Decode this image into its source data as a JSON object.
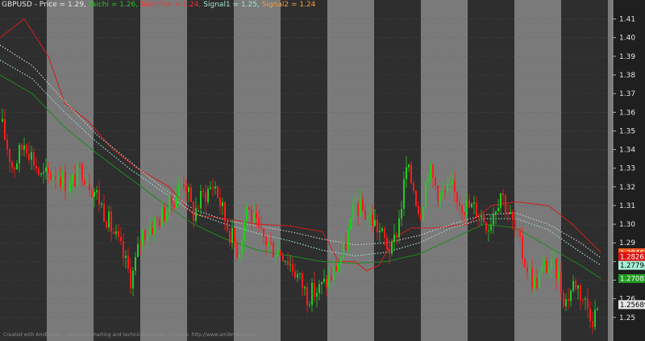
{
  "header": {
    "symbol": "GBPUSD",
    "price_label": "Price = 1.29,",
    "taichi_label": "Taichi = 1.26,",
    "taichifor_label": "TaichiFor = 1.24,",
    "signal1_label": "Signal1 = 1.25,",
    "signal2_label": "Signal2 = 1.24"
  },
  "footer": {
    "text": "Created with AmiBroker - advanced charting and technical analysis software. http://www.amibroker.com"
  },
  "colors": {
    "background_dark": "#2e2e2e",
    "background_light": "#7a7a7a",
    "up_candle": "#22cc22",
    "down_candle": "#ff1a1a",
    "taichi": "#1f8a1f",
    "taichifor": "#d21e1e",
    "signal1": "#9fd8c8",
    "signal2": "#c8c8c8"
  },
  "chart_data": {
    "type": "candlestick",
    "y_axis": {
      "min": 1.243,
      "max": 1.415,
      "ticks": [
        "1.25",
        "1.26",
        "1.27",
        "1.28",
        "1.29",
        "1.30",
        "1.31",
        "1.32",
        "1.33",
        "1.34",
        "1.35",
        "1.36",
        "1.37",
        "1.38",
        "1.39",
        "1.40",
        "1.41"
      ]
    },
    "last_values": {
      "taichifor": "1.28467",
      "signal2": "1.28263",
      "signal1": "1.27794",
      "taichi": "1.27085",
      "price": "1.25689"
    },
    "price_path": [
      [
        0,
        1.355
      ],
      [
        15,
        1.33
      ],
      [
        30,
        1.345
      ],
      [
        50,
        1.325
      ],
      [
        70,
        1.328
      ],
      [
        85,
        1.32
      ],
      [
        100,
        1.33
      ],
      [
        120,
        1.315
      ],
      [
        135,
        1.3
      ],
      [
        150,
        1.285
      ],
      [
        162,
        1.27
      ],
      [
        175,
        1.295
      ],
      [
        190,
        1.3
      ],
      [
        210,
        1.31
      ],
      [
        228,
        1.325
      ],
      [
        238,
        1.305
      ],
      [
        250,
        1.315
      ],
      [
        265,
        1.322
      ],
      [
        280,
        1.3
      ],
      [
        295,
        1.285
      ],
      [
        305,
        1.31
      ],
      [
        320,
        1.295
      ],
      [
        335,
        1.288
      ],
      [
        350,
        1.285
      ],
      [
        365,
        1.275
      ],
      [
        380,
        1.262
      ],
      [
        395,
        1.265
      ],
      [
        410,
        1.272
      ],
      [
        425,
        1.285
      ],
      [
        440,
        1.31
      ],
      [
        455,
        1.305
      ],
      [
        465,
        1.3
      ],
      [
        475,
        1.292
      ],
      [
        485,
        1.285
      ],
      [
        495,
        1.305
      ],
      [
        503,
        1.33
      ],
      [
        512,
        1.32
      ],
      [
        520,
        1.305
      ],
      [
        530,
        1.33
      ],
      [
        545,
        1.315
      ],
      [
        560,
        1.318
      ],
      [
        575,
        1.31
      ],
      [
        590,
        1.308
      ],
      [
        605,
        1.3
      ],
      [
        620,
        1.318
      ],
      [
        635,
        1.3
      ],
      [
        650,
        1.28
      ],
      [
        662,
        1.268
      ],
      [
        675,
        1.278
      ],
      [
        690,
        1.275
      ],
      [
        700,
        1.258
      ],
      [
        712,
        1.27
      ],
      [
        725,
        1.258
      ],
      [
        735,
        1.25
      ],
      [
        742,
        1.257
      ]
    ],
    "taichi": [
      [
        0,
        1.38
      ],
      [
        40,
        1.37
      ],
      [
        80,
        1.352
      ],
      [
        120,
        1.338
      ],
      [
        160,
        1.325
      ],
      [
        200,
        1.312
      ],
      [
        240,
        1.3
      ],
      [
        280,
        1.292
      ],
      [
        320,
        1.286
      ],
      [
        360,
        1.283
      ],
      [
        400,
        1.28
      ],
      [
        440,
        1.279
      ],
      [
        480,
        1.28
      ],
      [
        520,
        1.284
      ],
      [
        560,
        1.292
      ],
      [
        600,
        1.3
      ],
      [
        640,
        1.298
      ],
      [
        680,
        1.288
      ],
      [
        720,
        1.278
      ],
      [
        745,
        1.271
      ]
    ],
    "taichifor": [
      [
        0,
        1.4
      ],
      [
        15,
        1.405
      ],
      [
        30,
        1.41
      ],
      [
        45,
        1.4
      ],
      [
        60,
        1.39
      ],
      [
        80,
        1.365
      ],
      [
        110,
        1.355
      ],
      [
        140,
        1.34
      ],
      [
        170,
        1.33
      ],
      [
        210,
        1.32
      ],
      [
        240,
        1.305
      ],
      [
        280,
        1.303
      ],
      [
        320,
        1.3
      ],
      [
        360,
        1.299
      ],
      [
        400,
        1.296
      ],
      [
        420,
        1.28
      ],
      [
        440,
        1.28
      ],
      [
        455,
        1.275
      ],
      [
        470,
        1.278
      ],
      [
        490,
        1.293
      ],
      [
        510,
        1.298
      ],
      [
        540,
        1.298
      ],
      [
        580,
        1.3
      ],
      [
        610,
        1.31
      ],
      [
        640,
        1.312
      ],
      [
        680,
        1.31
      ],
      [
        710,
        1.3
      ],
      [
        745,
        1.285
      ]
    ],
    "signal1": [
      [
        0,
        1.388
      ],
      [
        40,
        1.378
      ],
      [
        80,
        1.36
      ],
      [
        120,
        1.344
      ],
      [
        160,
        1.33
      ],
      [
        200,
        1.318
      ],
      [
        240,
        1.306
      ],
      [
        280,
        1.3
      ],
      [
        320,
        1.295
      ],
      [
        360,
        1.291
      ],
      [
        400,
        1.286
      ],
      [
        440,
        1.283
      ],
      [
        480,
        1.285
      ],
      [
        520,
        1.29
      ],
      [
        560,
        1.298
      ],
      [
        600,
        1.303
      ],
      [
        640,
        1.303
      ],
      [
        680,
        1.297
      ],
      [
        720,
        1.285
      ],
      [
        745,
        1.278
      ]
    ],
    "signal2": [
      [
        0,
        1.396
      ],
      [
        40,
        1.385
      ],
      [
        80,
        1.366
      ],
      [
        120,
        1.348
      ],
      [
        160,
        1.334
      ],
      [
        200,
        1.32
      ],
      [
        240,
        1.308
      ],
      [
        280,
        1.302
      ],
      [
        320,
        1.299
      ],
      [
        360,
        1.296
      ],
      [
        400,
        1.292
      ],
      [
        440,
        1.289
      ],
      [
        480,
        1.29
      ],
      [
        520,
        1.294
      ],
      [
        560,
        1.3
      ],
      [
        600,
        1.305
      ],
      [
        640,
        1.306
      ],
      [
        680,
        1.3
      ],
      [
        720,
        1.29
      ],
      [
        745,
        1.282
      ]
    ]
  }
}
